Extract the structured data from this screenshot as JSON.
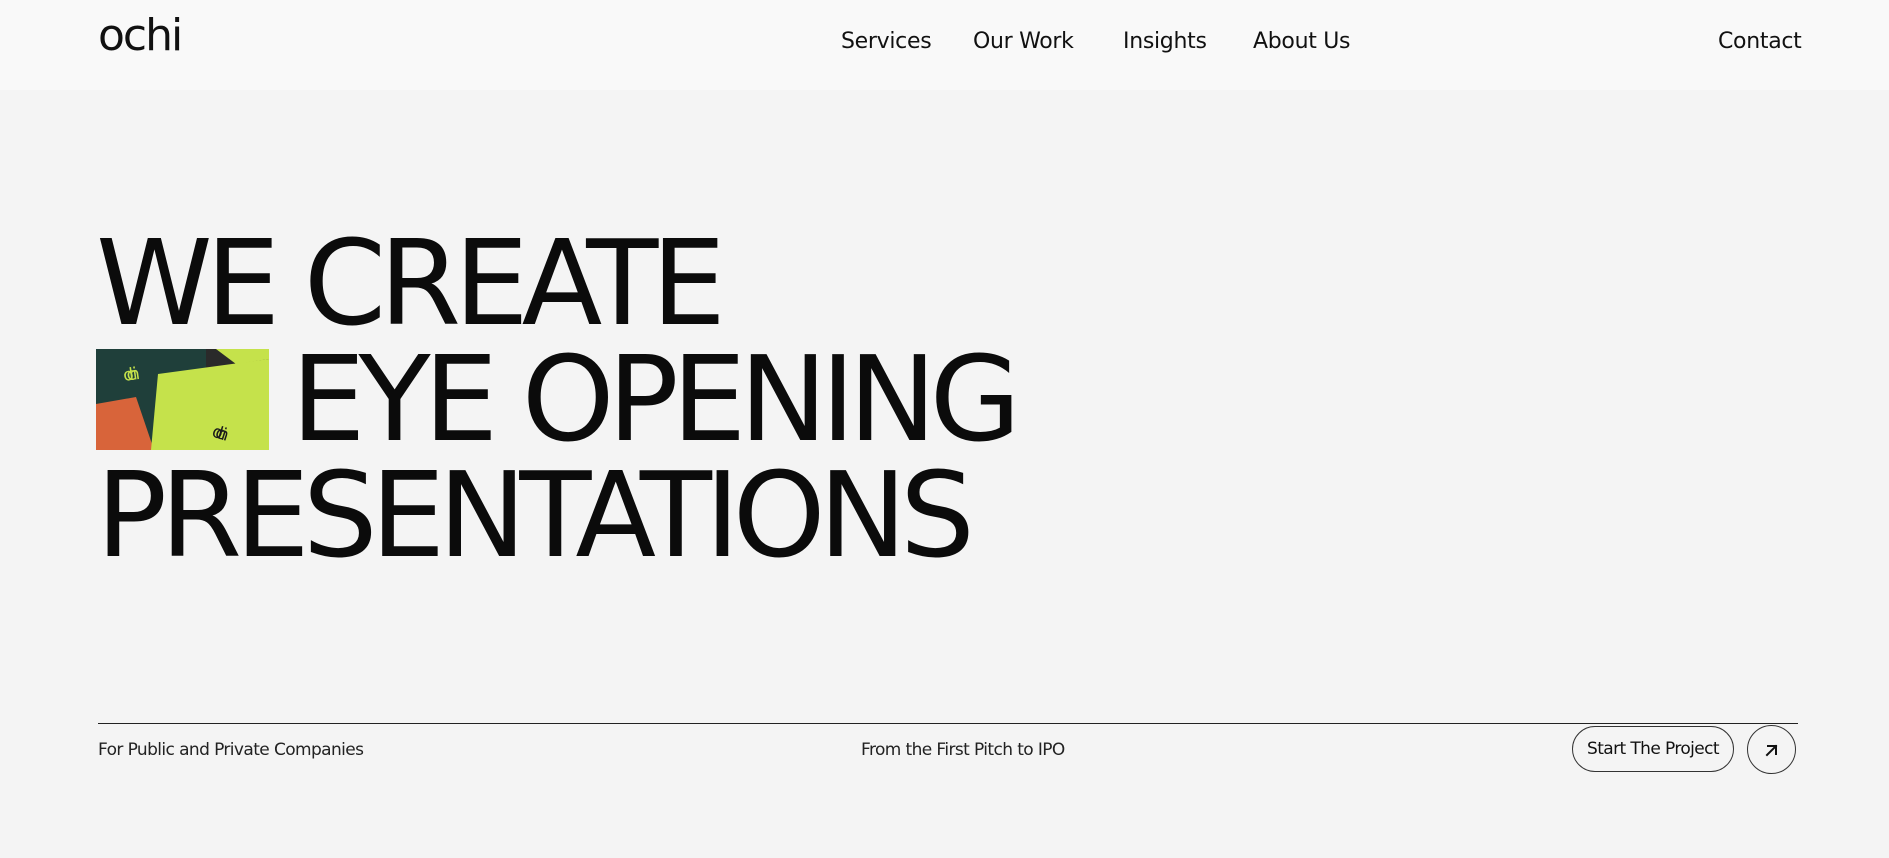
{
  "header": {
    "logo": "ochi",
    "nav": [
      "Services",
      "Our Work",
      "Insights",
      "About Us"
    ],
    "contact": "Contact"
  },
  "hero": {
    "line1": "WE CREATE",
    "line2": "EYE OPENING",
    "line3": "PRESENTATIONS",
    "thumbnail_text_1": "ochi",
    "thumbnail_text_2": "ochi"
  },
  "footer": {
    "left": "For Public and Private Companies",
    "center": "From the First Pitch to IPO",
    "cta": "Start The Project",
    "cta_icon": "arrow-up-right-icon"
  },
  "colors": {
    "background": "#f4f4f4",
    "navbar": "#f9f9f9",
    "text": "#111111",
    "thumb_green_dark": "#1f3f3a",
    "thumb_lime": "#c5e24b",
    "thumb_orange": "#d8643a"
  }
}
